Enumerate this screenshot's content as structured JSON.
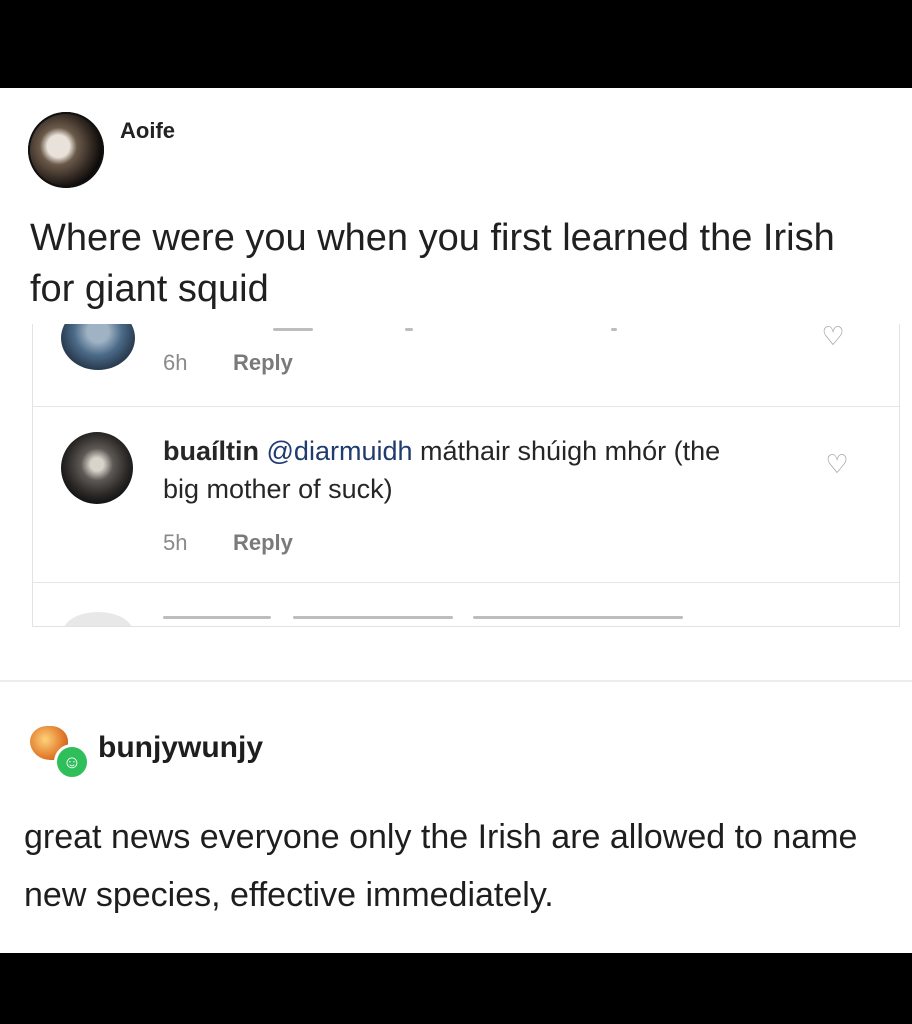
{
  "original_post": {
    "username": "Aoife",
    "text": "Where were you when you first learned the Irish for giant squid"
  },
  "comments": {
    "first": {
      "time": "6h",
      "reply_label": "Reply"
    },
    "second": {
      "username": "buaíltin",
      "mention": "@diarmuidh",
      "text": "máthair shúigh mhór (the big mother of suck)",
      "time": "5h",
      "reply_label": "Reply"
    }
  },
  "reblog": {
    "username": "bunjywunjy",
    "text": "great news everyone only the Irish are allowed to name new species, effective immediately."
  },
  "icons": [
    "heart-icon",
    "avatar"
  ]
}
